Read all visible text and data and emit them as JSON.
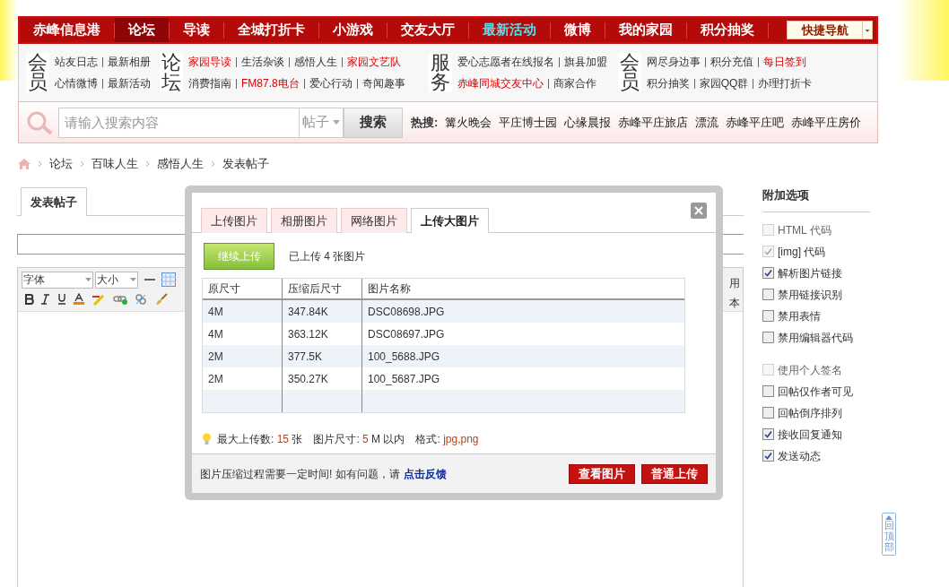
{
  "nav": {
    "items": [
      {
        "label": "赤峰信息港",
        "selected": false,
        "highlight": false
      },
      {
        "label": "论坛",
        "selected": true,
        "highlight": false
      },
      {
        "label": "导读",
        "selected": false,
        "highlight": false
      },
      {
        "label": "全城打折卡",
        "selected": false,
        "highlight": false
      },
      {
        "label": "小游戏",
        "selected": false,
        "highlight": false
      },
      {
        "label": "交友大厅",
        "selected": false,
        "highlight": false
      },
      {
        "label": "最新活动",
        "selected": false,
        "highlight": true
      },
      {
        "label": "微博",
        "selected": false,
        "highlight": false
      },
      {
        "label": "我的家园",
        "selected": false,
        "highlight": false
      },
      {
        "label": "积分抽奖",
        "selected": false,
        "highlight": false
      }
    ],
    "quick_nav": "快捷导航"
  },
  "link_groups": [
    {
      "badge": "会员",
      "rows": [
        [
          {
            "text": "站友日志",
            "red": false
          },
          {
            "text": "最新相册",
            "red": false
          }
        ],
        [
          {
            "text": "心情微博",
            "red": false
          },
          {
            "text": "最新活动",
            "red": false
          }
        ]
      ]
    },
    {
      "badge": "论坛",
      "rows": [
        [
          {
            "text": "家园导读",
            "red": true
          },
          {
            "text": "生活杂谈",
            "red": false
          },
          {
            "text": "感悟人生",
            "red": false
          },
          {
            "text": "家园文艺队",
            "red": true
          }
        ],
        [
          {
            "text": "消费指南",
            "red": false
          },
          {
            "text": "FM87.8电台",
            "red": true
          },
          {
            "text": "爱心行动",
            "red": false
          },
          {
            "text": "奇闻趣事",
            "red": false
          }
        ]
      ]
    },
    {
      "badge": "服务",
      "rows": [
        [
          {
            "text": "爱心志愿者在线报名",
            "red": false
          },
          {
            "text": "旗县加盟",
            "red": false
          }
        ],
        [
          {
            "text": "赤峰同城交友中心",
            "red": true
          },
          {
            "text": "商家合作",
            "red": false
          }
        ]
      ]
    },
    {
      "badge": "会员",
      "rows": [
        [
          {
            "text": "网尽身边事",
            "red": false
          },
          {
            "text": "积分充值",
            "red": false
          },
          {
            "text": "每日签到",
            "red": true
          }
        ],
        [
          {
            "text": "积分抽奖",
            "red": false
          },
          {
            "text": "家园QQ群",
            "red": false
          },
          {
            "text": "办理打折卡",
            "red": false
          }
        ]
      ]
    }
  ],
  "search": {
    "placeholder": "请输入搜索内容",
    "scope": "帖子",
    "button": "搜索",
    "hot_label": "热搜:",
    "hot": [
      "篝火晚会",
      "平庄博士园",
      "心缘晨报",
      "赤峰平庄旅店",
      "漂流",
      "赤峰平庄吧",
      "赤峰平庄房价"
    ]
  },
  "breadcrumb": [
    "论坛",
    "百味人生",
    "感悟人生",
    "发表帖子"
  ],
  "editor": {
    "tab": "发表帖子",
    "font": "字体",
    "size": "大小",
    "peek_1": "用",
    "peek_2": "本"
  },
  "dialog": {
    "tabs": [
      {
        "label": "上传图片",
        "selected": false
      },
      {
        "label": "相册图片",
        "selected": false
      },
      {
        "label": "网络图片",
        "selected": false
      },
      {
        "label": "上传大图片",
        "selected": true
      }
    ],
    "continue_button": "继续上传",
    "uploaded_info": "已上传 4 张图片",
    "columns": [
      "原尺寸",
      "压缩后尺寸",
      "图片名称"
    ],
    "rows": [
      [
        "4M",
        "347.84K",
        "DSC08698.JPG"
      ],
      [
        "4M",
        "363.12K",
        "DSC08697.JPG"
      ],
      [
        "2M",
        "377.5K",
        "100_5688.JPG"
      ],
      [
        "2M",
        "350.27K",
        "100_5687.JPG"
      ]
    ],
    "limits": [
      {
        "label": "最大上传数:",
        "value": "15",
        "unit": "张"
      },
      {
        "label": "图片尺寸:",
        "value": "5",
        "unit": "M 以内"
      },
      {
        "label": "格式:",
        "value": "jpg,png"
      }
    ],
    "footer_note": "图片压缩过程需要一定时间! 如有问题，请",
    "feedback_link": "点击反馈",
    "buttons": [
      "查看图片",
      "普通上传"
    ]
  },
  "options": {
    "title": "附加选项",
    "groups": [
      [
        {
          "label": "HTML 代码",
          "checked": false,
          "disabled": true
        },
        {
          "label": "[img] 代码",
          "checked": true,
          "disabled": true
        },
        {
          "label": "解析图片链接",
          "checked": true,
          "disabled": false
        },
        {
          "label": "禁用链接识别",
          "checked": false,
          "disabled": false
        },
        {
          "label": "禁用表情",
          "checked": false,
          "disabled": false
        },
        {
          "label": "禁用编辑器代码",
          "checked": false,
          "disabled": false
        }
      ],
      [
        {
          "label": "使用个人签名",
          "checked": false,
          "disabled": true
        },
        {
          "label": "回帖仅作者可见",
          "checked": false,
          "disabled": false
        },
        {
          "label": "回帖倒序排列",
          "checked": false,
          "disabled": false
        },
        {
          "label": "接收回复通知",
          "checked": true,
          "disabled": false
        },
        {
          "label": "发送动态",
          "checked": true,
          "disabled": false
        }
      ]
    ]
  },
  "back_to_top": "回顶部"
}
